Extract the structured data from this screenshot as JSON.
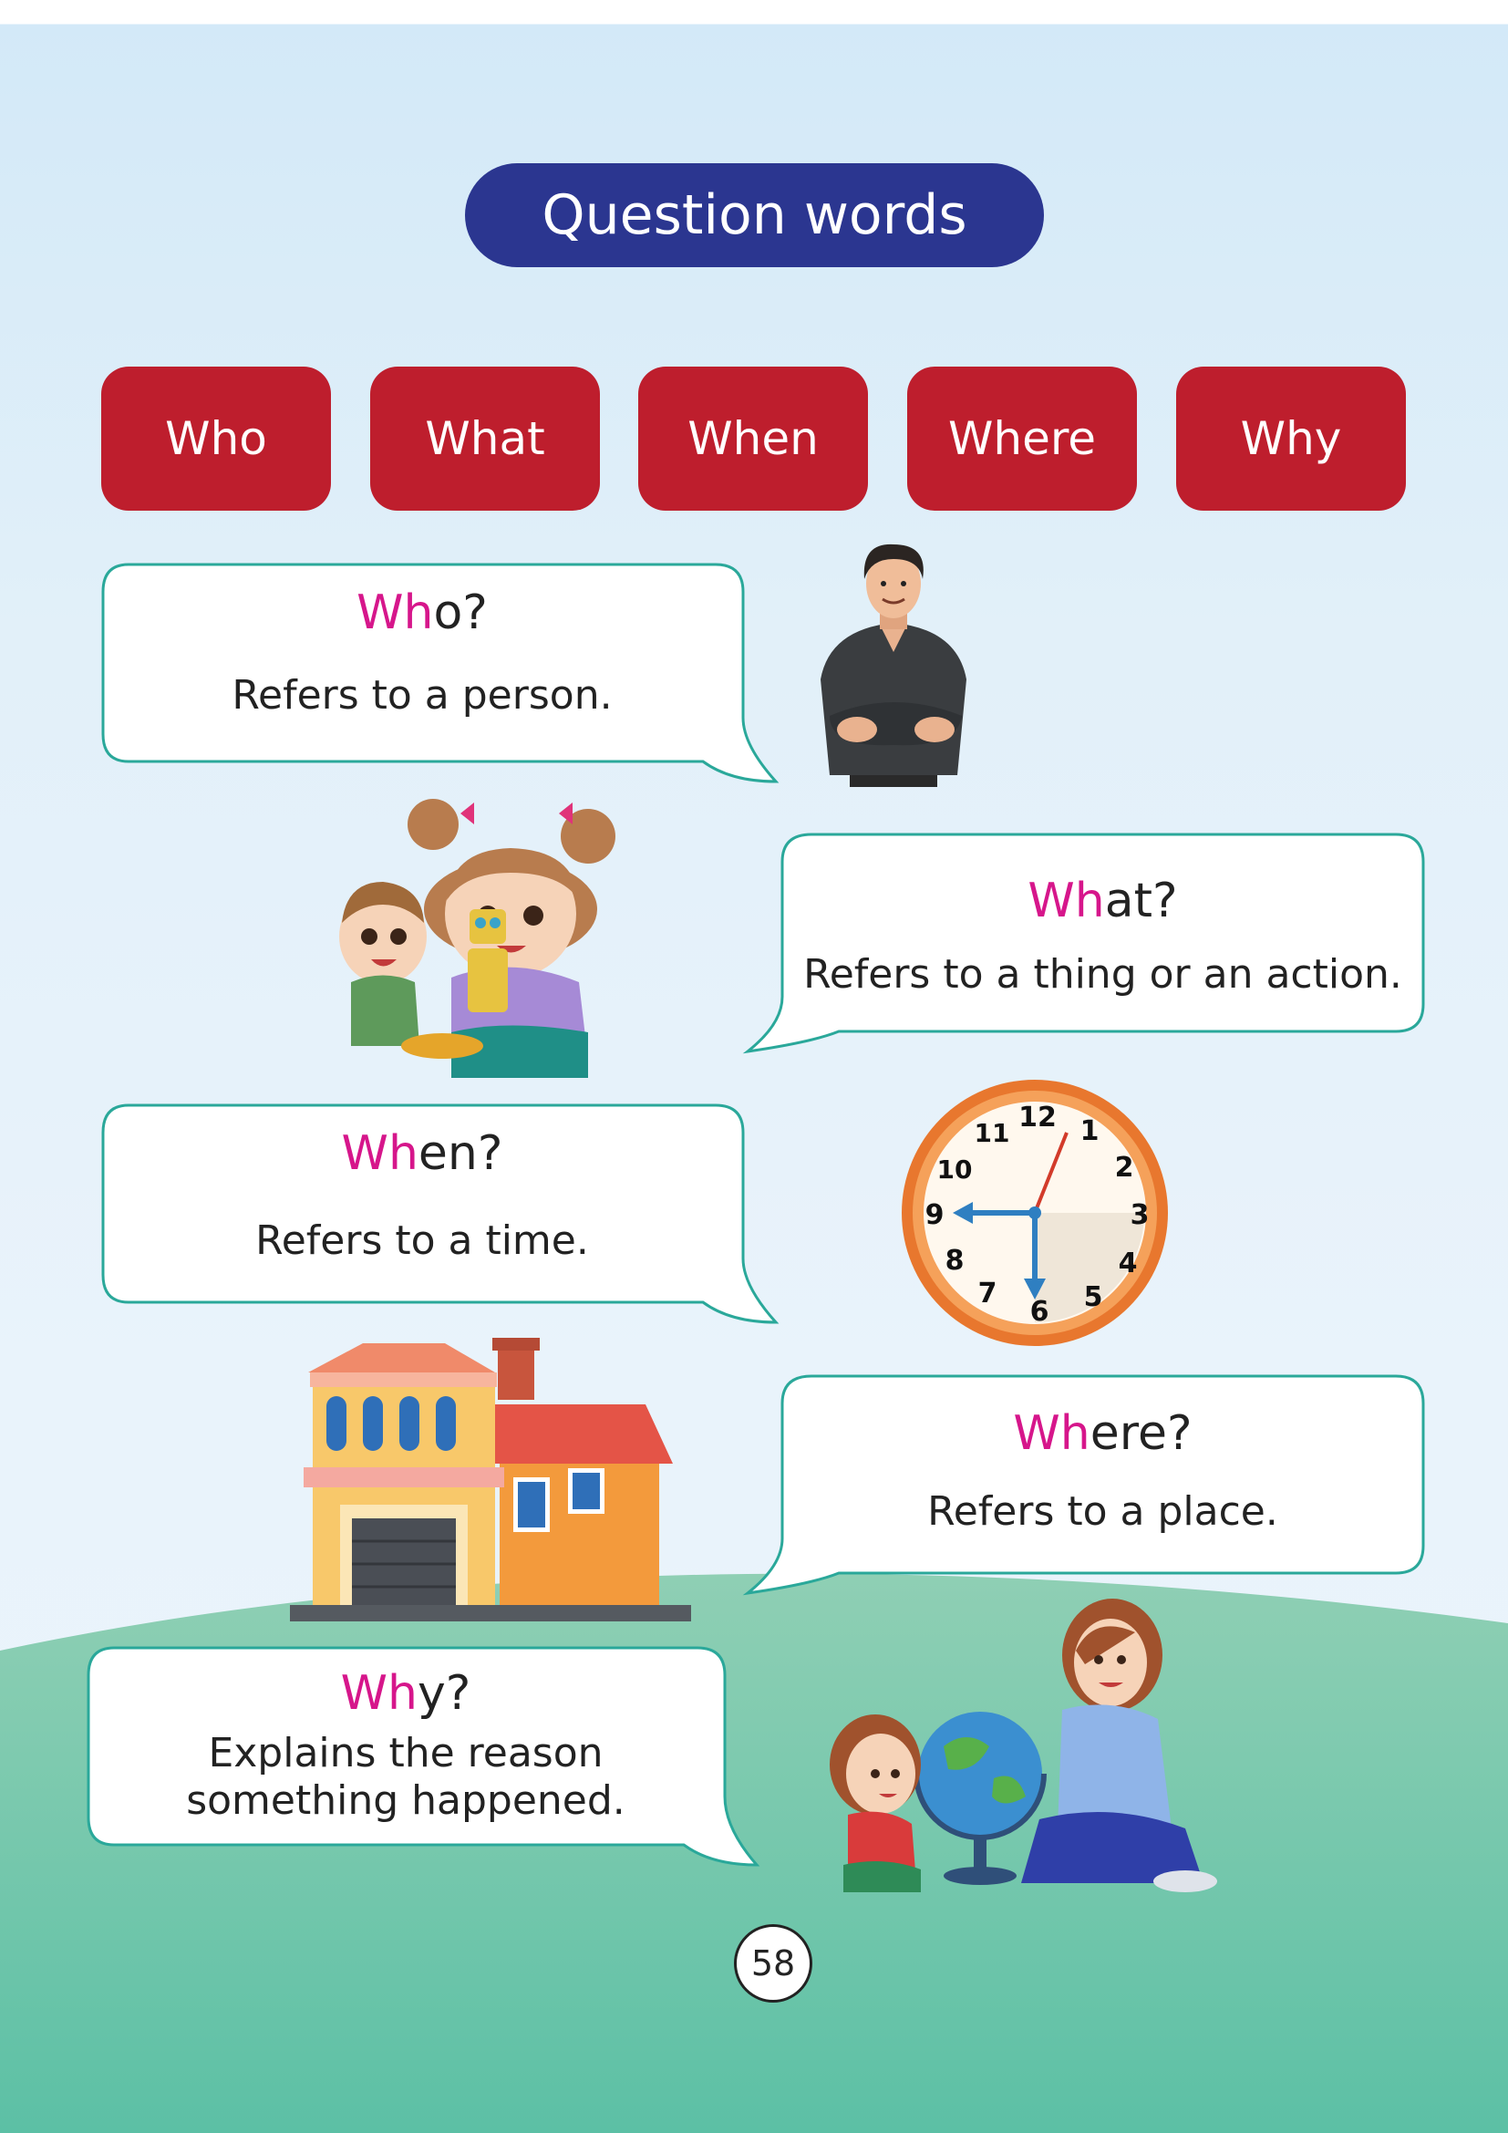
{
  "title": "Question words",
  "words": [
    "Who",
    "What",
    "When",
    "Where",
    "Why"
  ],
  "cards": [
    {
      "hl": "Wh",
      "rest": "o?",
      "desc": [
        "Refers to a person."
      ]
    },
    {
      "hl": "Wh",
      "rest": "at?",
      "desc": [
        "Refers to a thing or an action."
      ]
    },
    {
      "hl": "Wh",
      "rest": "en?",
      "desc": [
        "Refers to a time."
      ]
    },
    {
      "hl": "Wh",
      "rest": "ere?",
      "desc": [
        "Refers to a place."
      ]
    },
    {
      "hl": "Wh",
      "rest": "y?",
      "desc": [
        "Explains the reason",
        "something happened."
      ]
    }
  ],
  "clock": {
    "numbers": [
      "12",
      "1",
      "2",
      "3",
      "4",
      "5",
      "6",
      "7",
      "8",
      "9",
      "10",
      "11"
    ]
  },
  "page_number": "58",
  "colors": {
    "title_bg": "#2b3690",
    "word_bg": "#be1e2d",
    "highlight": "#d6168b",
    "bubble_border": "#2aa89a",
    "hill": "#6cc4a6"
  }
}
